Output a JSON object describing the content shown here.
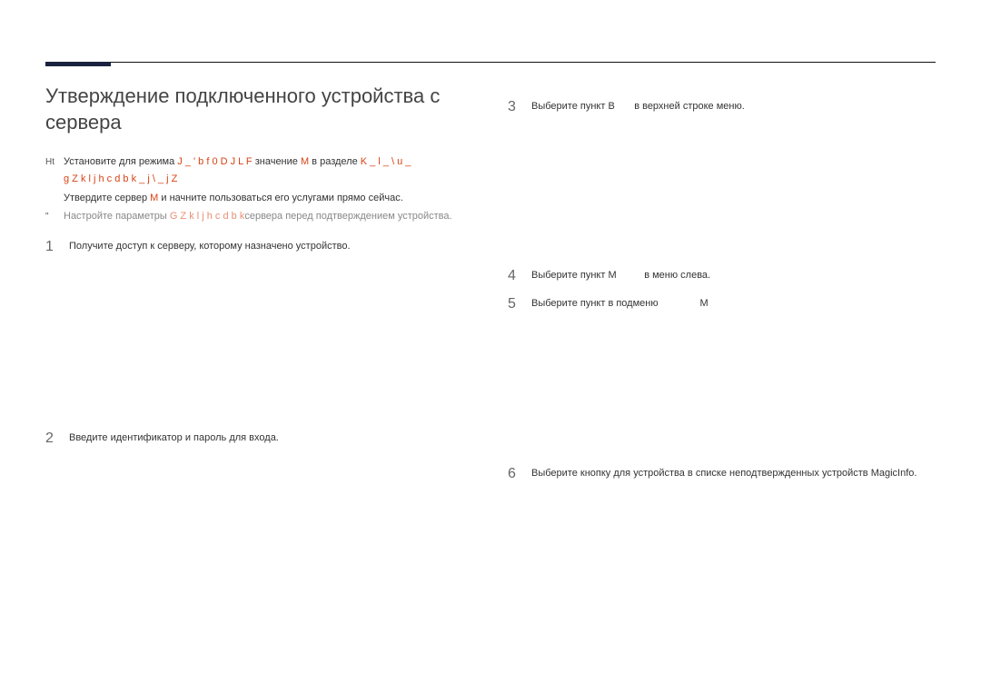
{
  "title": "Утверждение подключенного устройства с сервера",
  "notes": {
    "marker1": "Ht",
    "line1a": "Установите для режима ",
    "line1_red1": "J _ ' b f   0 D J L F",
    "line1_mid1": " значение ",
    "line1_red2": "M",
    "line1_mid2": " в разделе ",
    "line1_red3": "K _ l _ \\ u _",
    "line1_red4": "g Z k l j h c d b   k _ j \\ _ j Z",
    "line2a": "Утвердите сервер ",
    "line2_red1": "M",
    "line2b": " и начните пользоваться его услугами прямо сейчас.",
    "marker3": "\"",
    "line3a": "Настройте параметры  ",
    "line3_red1": "G Z k l j h c d b   k",
    "line3b": "сервера перед подтверждением устройства."
  },
  "left_steps": {
    "s1_num": "1",
    "s1_text": "Получите доступ к серверу, которому назначено устройство.",
    "s2_num": "2",
    "s2_text": "Введите идентификатор и пароль для входа."
  },
  "right_steps": {
    "s3_num": "3",
    "s3_a": "Выберите пункт ",
    "s3_b": "B",
    "s3_c": " в верхней строке меню.",
    "s4_num": "4",
    "s4_a": "Выберите пункт ",
    "s4_b": "M",
    "s4_c": " в меню слева.",
    "s5_num": "5",
    "s5_a": "Выберите пункт ",
    "s5_b": "в подменю ",
    "s5_c": "M",
    "s6_num": "6",
    "s6_a": "Выберите кнопку ",
    "s6_b": "для устройства в списке неподтвержденных устройств MagicInfo."
  }
}
